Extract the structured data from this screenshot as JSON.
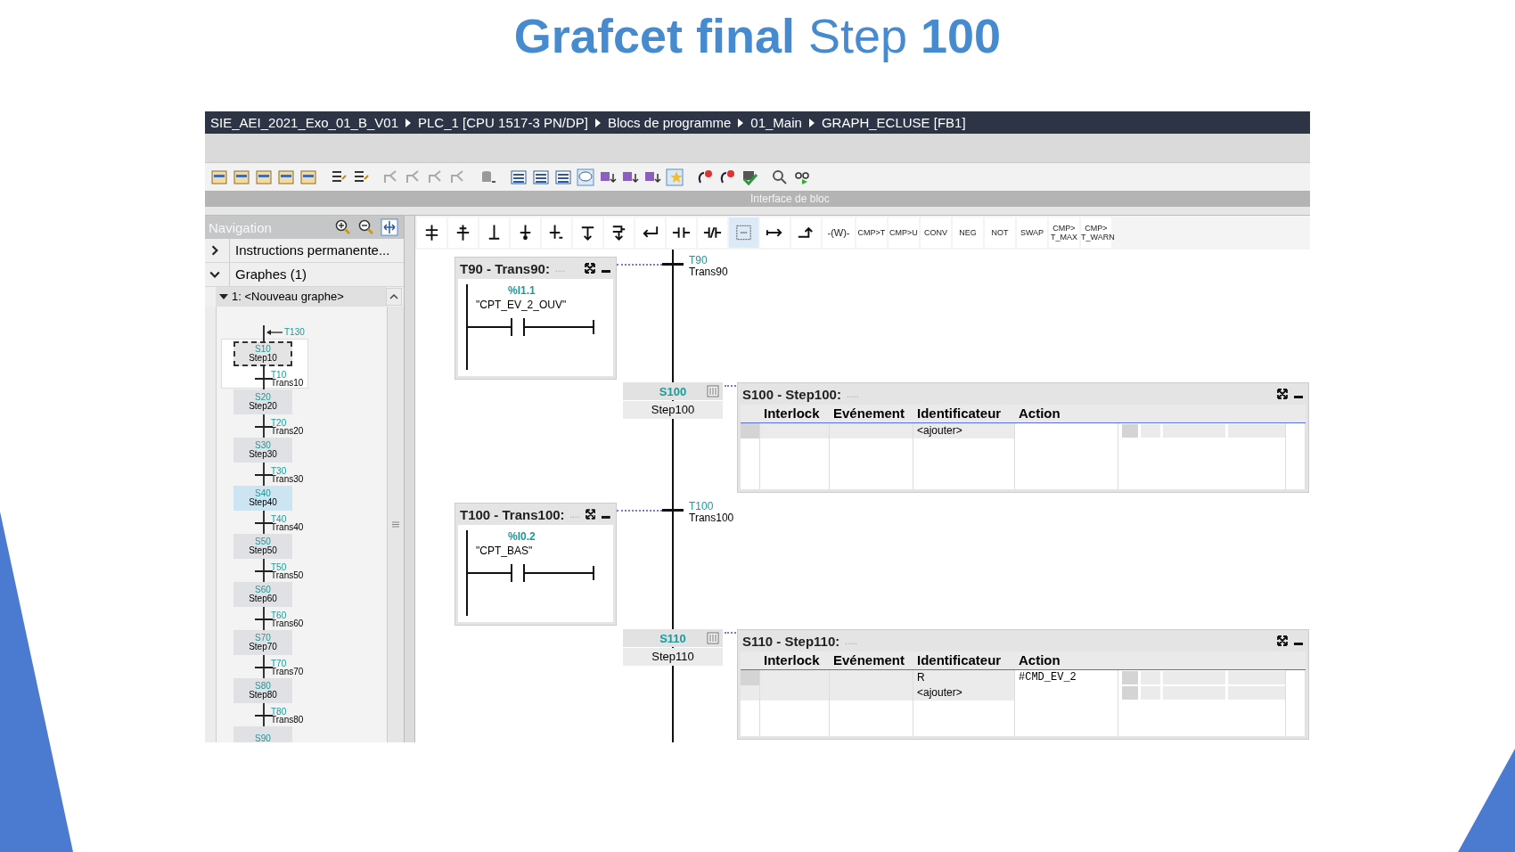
{
  "slide_title": "**Grafcet final** Step **100**",
  "breadcrumb": [
    "SIE_AEI_2021_Exo_01_B_V01",
    "PLC_1 [CPU 1517-3 PN/DP]",
    "Blocs de programme",
    "01_Main",
    "GRAPH_ECLUSE [FB1]"
  ],
  "block_interface": "Interface de bloc",
  "navigation": {
    "title": "Navigation",
    "sections": [
      {
        "label": "Instructions permanente...",
        "expanded": false
      },
      {
        "label": "Graphes (1)",
        "expanded": true
      }
    ],
    "graph": {
      "label": "1: <Nouveau graphe>",
      "expanded": true,
      "entry_transition": "T130",
      "steps": [
        {
          "number": "S10",
          "name": "Step10",
          "selected": true,
          "highlighted": false
        },
        {
          "number": "S20",
          "name": "Step20",
          "selected": false,
          "highlighted": false
        },
        {
          "number": "S30",
          "name": "Step30",
          "selected": false,
          "highlighted": false
        },
        {
          "number": "S40",
          "name": "Step40",
          "selected": false,
          "highlighted": true
        },
        {
          "number": "S50",
          "name": "Step50",
          "selected": false,
          "highlighted": false
        },
        {
          "number": "S60",
          "name": "Step60",
          "selected": false,
          "highlighted": false
        },
        {
          "number": "S70",
          "name": "Step70",
          "selected": false,
          "highlighted": false
        },
        {
          "number": "S80",
          "name": "Step80",
          "selected": false,
          "highlighted": false
        },
        {
          "number": "S90",
          "selected": false,
          "highlighted": false
        }
      ],
      "transitions": [
        {
          "number": "T10",
          "name": "Trans10"
        },
        {
          "number": "T20",
          "name": "Trans20"
        },
        {
          "number": "T30",
          "name": "Trans30"
        },
        {
          "number": "T40",
          "name": "Trans40"
        },
        {
          "number": "T50",
          "name": "Trans50"
        },
        {
          "number": "T60",
          "name": "Trans60"
        },
        {
          "number": "T70",
          "name": "Trans70"
        },
        {
          "number": "T80",
          "name": "Trans80"
        }
      ]
    }
  },
  "instructions": [
    "-(W)-",
    "CMP>T",
    "CMP>U",
    "CONV",
    "NEG",
    "NOT",
    "SWAP",
    "CMP>\nT_MAX",
    "CMP>\nT_WARN"
  ],
  "transitions": [
    {
      "number": "T90",
      "name": "Trans90",
      "panel": {
        "title": "T90 - Trans90:",
        "comment": "....",
        "address": "%I1.1",
        "tag": "\"CPT_EV_2_OUV\""
      }
    },
    {
      "number": "T100",
      "name": "Trans100",
      "panel": {
        "title": "T100 - Trans100:",
        "comment": "....",
        "address": "%I0.2",
        "tag": "\"CPT_BAS\""
      }
    }
  ],
  "steps": [
    {
      "number": "S100",
      "name": "Step100",
      "panel": {
        "title": "S100 - Step100:",
        "comment": ".....",
        "columns": [
          "Interlock",
          "Evénement",
          "Identificateur",
          "Action"
        ],
        "rows": [
          {
            "identifier": "<ajouter>"
          }
        ]
      }
    },
    {
      "number": "S110",
      "name": "Step110",
      "panel": {
        "title": "S110 - Step110:",
        "comment": ".....",
        "columns": [
          "Interlock",
          "Evénement",
          "Identificateur",
          "Action"
        ],
        "rows": [
          {
            "identifier": "R",
            "action": "#CMD_EV_2"
          },
          {
            "identifier": "<ajouter>"
          }
        ]
      }
    }
  ]
}
